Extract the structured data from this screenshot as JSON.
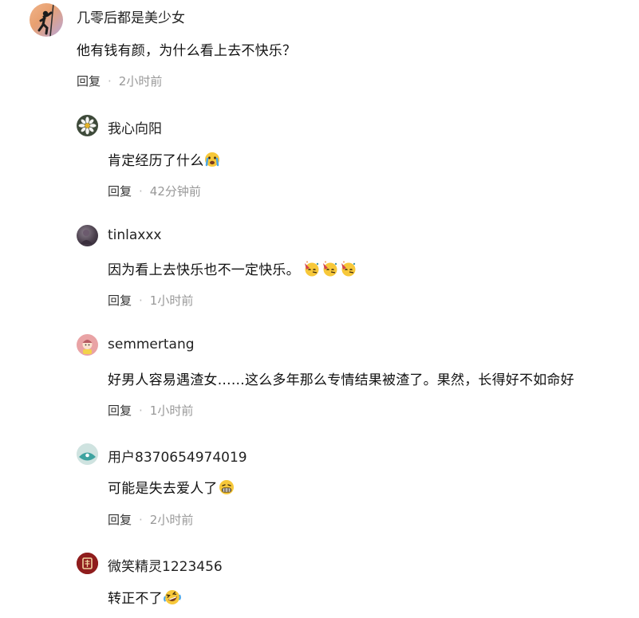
{
  "comments": [
    {
      "author": "几零后都是美少女",
      "text": "他有钱有颜，为什么看上去不快乐？",
      "reply_label": "回复",
      "time": "2小时前",
      "avatar_icon": "climber-silhouette-avatar"
    },
    {
      "author": "我心向阳",
      "text": "肯定经历了什么",
      "emojis": [
        "crying-emoji"
      ],
      "reply_label": "回复",
      "time": "42分钟前",
      "avatar_icon": "daisy-avatar"
    },
    {
      "author": "tinlaxxx",
      "text": "因为看上去快乐也不一定快乐。",
      "emojis": [
        "party-emoji",
        "party-emoji",
        "party-emoji"
      ],
      "reply_label": "回复",
      "time": "1小时前",
      "avatar_icon": "dark-photo-avatar"
    },
    {
      "author": "semmertang",
      "text": "好男人容易遇渣女……这么多年那么专情结果被渣了。果然，长得好不如命好",
      "reply_label": "回复",
      "time": "1小时前",
      "avatar_icon": "pink-character-avatar"
    },
    {
      "author": "用户8370654974019",
      "text": "可能是失去爱人了",
      "emojis": [
        "grimace-emoji"
      ],
      "reply_label": "回复",
      "time": "2小时前",
      "avatar_icon": "default-teal-avatar"
    },
    {
      "author": "微笑精灵1223456",
      "text": "转正不了",
      "emojis": [
        "laughing-crying-emoji"
      ],
      "reply_label": "回复",
      "time": "",
      "avatar_icon": "red-logo-avatar"
    }
  ],
  "colors": {
    "meta": "#999999",
    "reply": "#333333",
    "text": "#111111",
    "accent_teal": "#5fb3b3"
  }
}
